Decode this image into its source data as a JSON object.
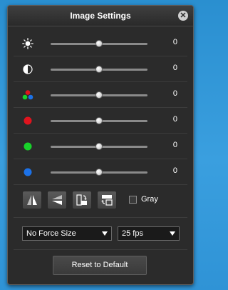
{
  "window": {
    "title": "Image Settings",
    "close_icon": "close-icon"
  },
  "sliders": [
    {
      "id": "brightness",
      "icon": "brightness-icon",
      "value": "0",
      "level": 0.5
    },
    {
      "id": "contrast",
      "icon": "contrast-icon",
      "value": "0",
      "level": 0.5
    },
    {
      "id": "saturation",
      "icon": "color-dots-icon",
      "value": "0",
      "level": 0.5
    },
    {
      "id": "red",
      "icon": "red-dot-icon",
      "color": "#e0141e",
      "value": "0",
      "level": 0.5
    },
    {
      "id": "green",
      "icon": "green-dot-icon",
      "color": "#18d22a",
      "value": "0",
      "level": 0.5
    },
    {
      "id": "blue",
      "icon": "blue-dot-icon",
      "color": "#1c72e8",
      "value": "0",
      "level": 0.5
    }
  ],
  "tools": [
    {
      "name": "flip-horizontal-icon"
    },
    {
      "name": "flip-vertical-icon"
    },
    {
      "name": "rotate-left-icon"
    },
    {
      "name": "rotate-right-icon"
    }
  ],
  "gray": {
    "label": "Gray",
    "checked": false
  },
  "size_select": {
    "value": "No Force Size"
  },
  "fps_select": {
    "value": "25 fps"
  },
  "reset_button": {
    "label": "Reset to Default"
  }
}
